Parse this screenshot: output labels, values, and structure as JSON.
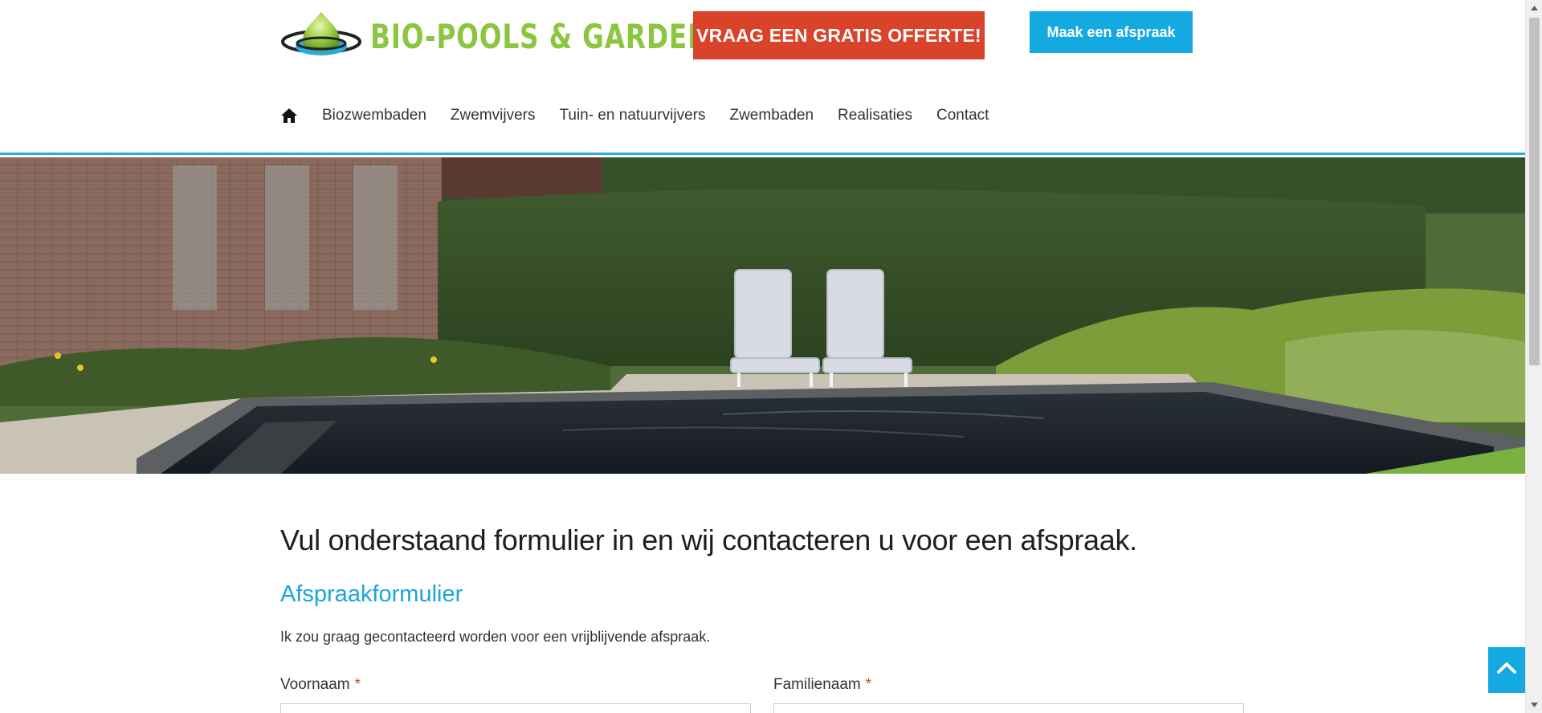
{
  "brand": {
    "name": "BIO-POOLS & GARDENS",
    "logo_icon": "water-drop-logo-icon",
    "brand_green": "#8cc63f"
  },
  "header": {
    "quote_button": "VRAAG EEN GRATIS OFFERTE!",
    "appointment_button": "Maak een afspraak",
    "quote_color": "#d9432a",
    "accent_color": "#15a9e1"
  },
  "nav": {
    "home_icon": "home-icon",
    "items": [
      {
        "label": "Biozwembaden"
      },
      {
        "label": "Zwemvijvers"
      },
      {
        "label": "Tuin- en natuurvijvers"
      },
      {
        "label": "Zwembaden"
      },
      {
        "label": "Realisaties"
      },
      {
        "label": "Contact"
      }
    ]
  },
  "hero": {
    "image": "garden-pool-photo"
  },
  "main": {
    "intro": "Vul onderstaand formulier in en wij contacteren u voor een afspraak.",
    "form_title": "Afspraakformulier",
    "form_description": "Ik zou graag gecontacteerd worden voor een vrijblijvende afspraak.",
    "fields": [
      {
        "label": "Voornaam",
        "required_mark": "*",
        "value": ""
      },
      {
        "label": "Familienaam",
        "required_mark": "*",
        "value": ""
      }
    ]
  },
  "back_to_top_icon": "chevron-up-icon"
}
